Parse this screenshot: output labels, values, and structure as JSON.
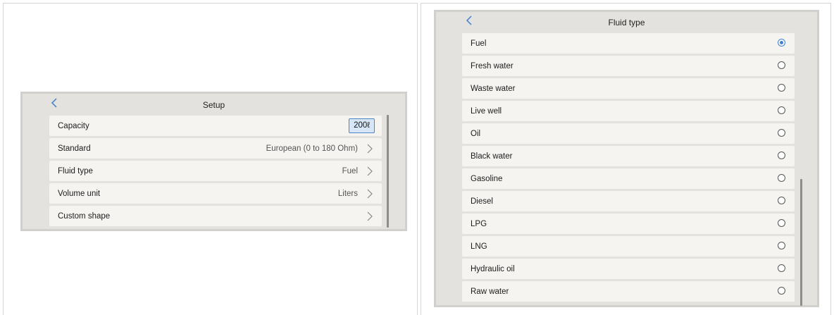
{
  "setup": {
    "title": "Setup",
    "rows": [
      {
        "label": "Capacity",
        "value": "200ℓ"
      },
      {
        "label": "Standard",
        "value": "European (0 to 180 Ohm)"
      },
      {
        "label": "Fluid type",
        "value": "Fuel"
      },
      {
        "label": "Volume unit",
        "value": "Liters"
      },
      {
        "label": "Custom shape",
        "value": ""
      }
    ]
  },
  "fluid": {
    "title": "Fluid type",
    "selected": "Fuel",
    "options": [
      "Fuel",
      "Fresh water",
      "Waste water",
      "Live well",
      "Oil",
      "Black water",
      "Gasoline",
      "Diesel",
      "LPG",
      "LNG",
      "Hydraulic oil",
      "Raw water"
    ]
  },
  "colors": {
    "accent": "#3f7fd0",
    "panel": "#e4e2de",
    "row": "#f6f4f1"
  },
  "icons": {
    "back": "chevron-left-icon",
    "forward": "chevron-right-icon",
    "radio": "radio-icon"
  }
}
